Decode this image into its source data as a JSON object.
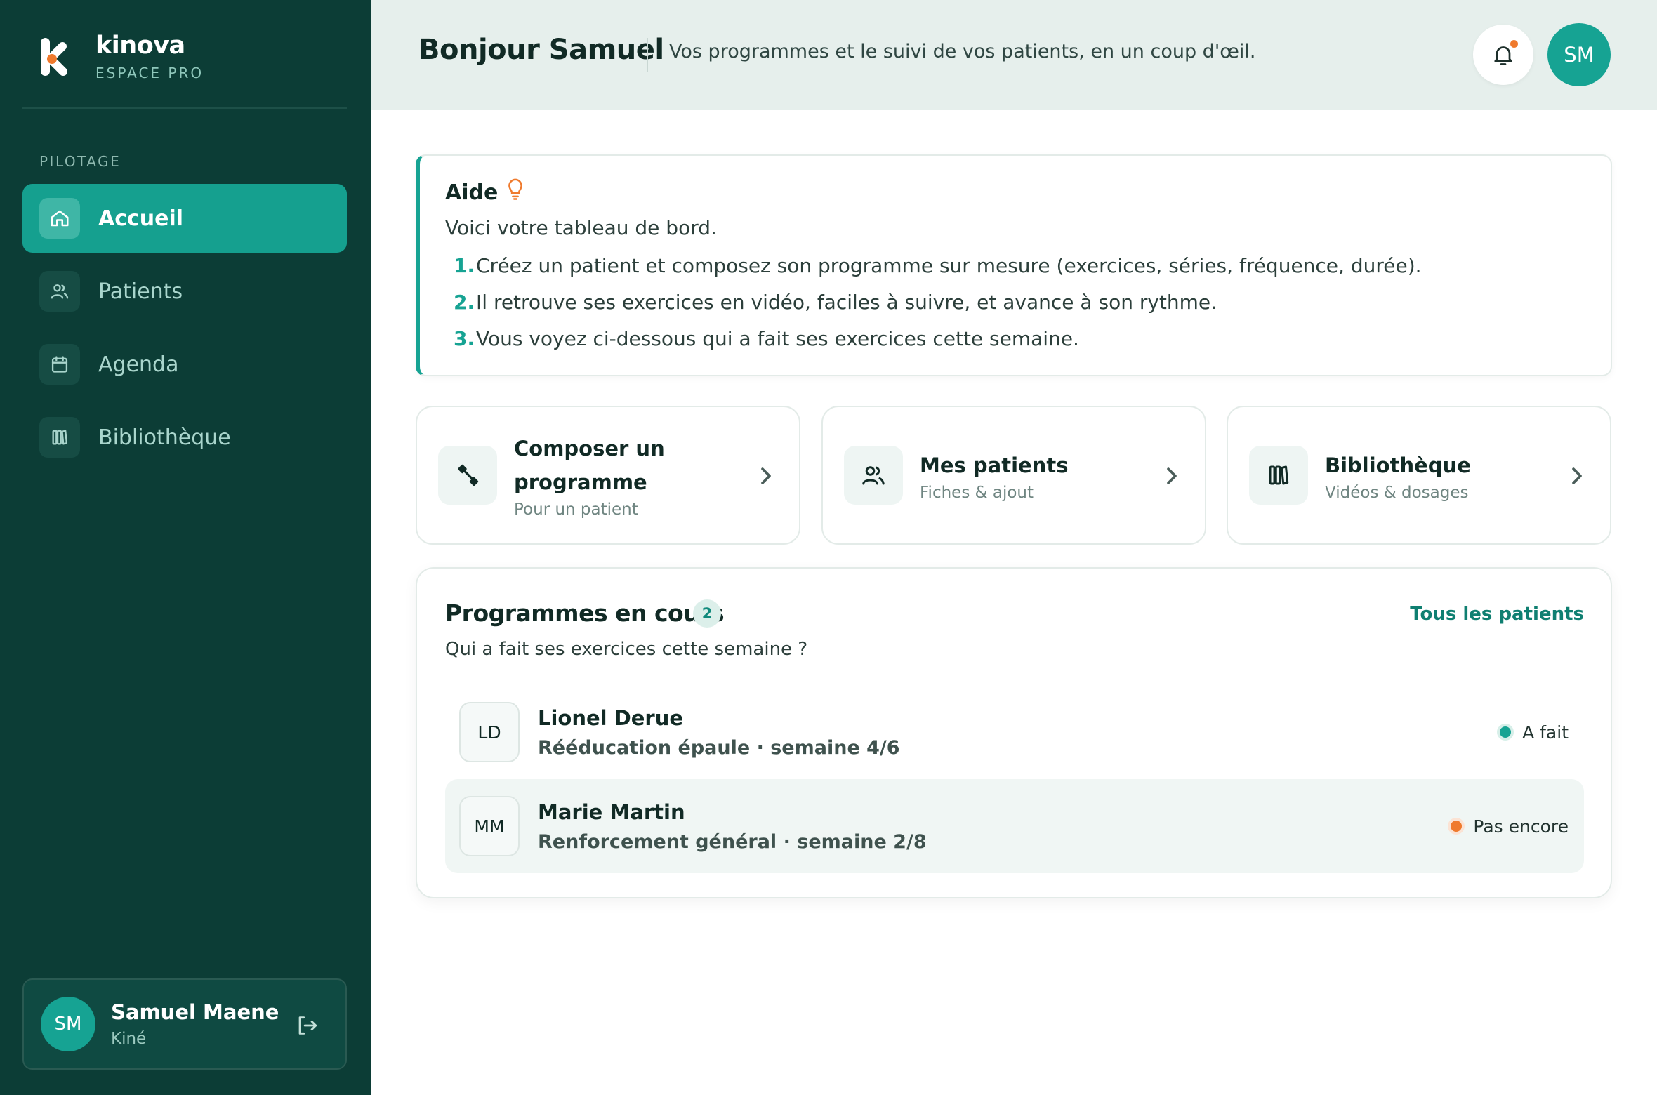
{
  "brand": {
    "name": "kinova",
    "subtitle": "ESPACE PRO"
  },
  "sidebar": {
    "section_label": "PILOTAGE",
    "items": [
      {
        "label": "Accueil",
        "icon": "home-icon",
        "active": true
      },
      {
        "label": "Patients",
        "icon": "users-icon",
        "active": false
      },
      {
        "label": "Agenda",
        "icon": "calendar-icon",
        "active": false
      },
      {
        "label": "Bibliothèque",
        "icon": "library-icon",
        "active": false
      }
    ],
    "user": {
      "initials": "SM",
      "name": "Samuel Maene",
      "role": "Kiné"
    }
  },
  "header": {
    "greeting": "Bonjour Samuel",
    "tagline": "Vos programmes et le suivi de vos patients, en un coup d'œil.",
    "avatar_initials": "SM",
    "has_notification": true
  },
  "help": {
    "title": "Aide",
    "intro": "Voici votre tableau de bord.",
    "steps": [
      {
        "num": "1.",
        "text": "Créez un patient et composez son programme sur mesure (exercices, séries, fréquence, durée)."
      },
      {
        "num": "2.",
        "text": "Il retrouve ses exercices en vidéo, faciles à suivre, et avance à son rythme."
      },
      {
        "num": "3.",
        "text": "Vous voyez ci-dessous qui a fait ses exercices cette semaine."
      }
    ]
  },
  "cards": [
    {
      "title_line1": "Composer un",
      "title_line2": "programme",
      "subtitle": "Pour un patient",
      "icon": "wrench-icon"
    },
    {
      "title": "Mes patients",
      "subtitle": "Fiches & ajout",
      "icon": "users-icon"
    },
    {
      "title": "Bibliothèque",
      "subtitle": "Vidéos & dosages",
      "icon": "library-icon"
    }
  ],
  "programmes": {
    "title": "Programmes en cours",
    "count": "2",
    "subtitle": "Qui a fait ses exercices cette semaine ?",
    "link": "Tous les patients",
    "rows": [
      {
        "initials": "LD",
        "name": "Lionel Derue",
        "programme": "Rééducation épaule · semaine 4/6",
        "status": "A fait",
        "status_color": "#16a393"
      },
      {
        "initials": "MM",
        "name": "Marie Martin",
        "programme": "Renforcement général · semaine 2/8",
        "status": "Pas encore",
        "status_color": "#ef7a2d"
      }
    ]
  },
  "colors": {
    "sidebar": "#0c3d36",
    "accent": "#16a393",
    "warning": "#ef7a2d"
  }
}
